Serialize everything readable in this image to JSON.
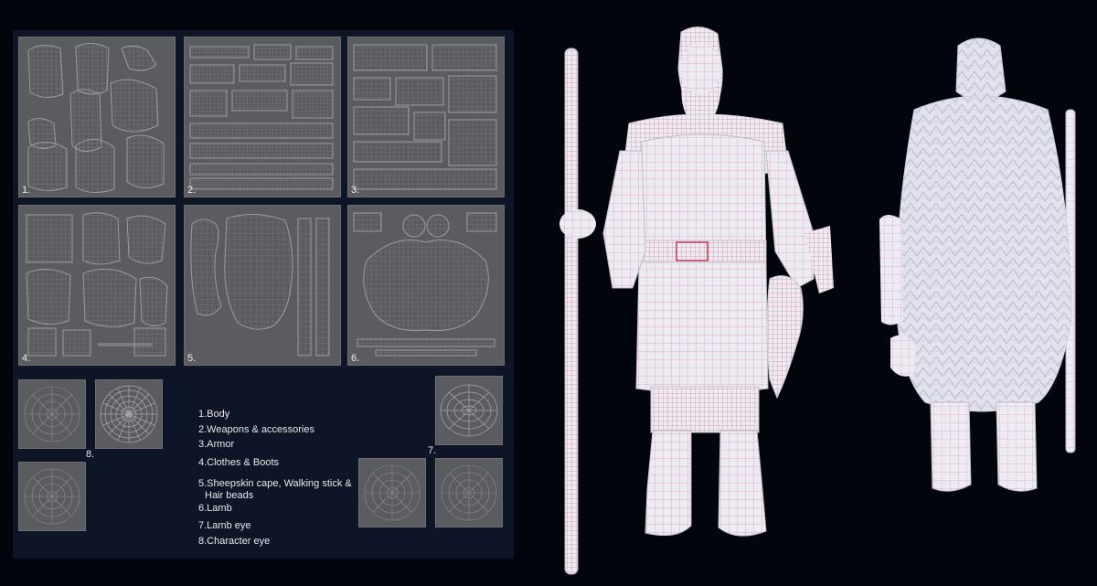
{
  "uv_labels": [
    "1.",
    "2.",
    "3.",
    "4.",
    "5.",
    "6.",
    "7.",
    "8."
  ],
  "legend": [
    "1.Body",
    "2.Weapons & accessories",
    "3.Armor",
    "4.Clothes & Boots",
    "5.Sheepskin cape, Walking stick &",
    "Hair beads",
    "6.Lamb",
    "7.Lamb eye",
    "8.Character eye"
  ],
  "colors": {
    "panel": "#0d1526",
    "uv_tile": "#5a5c5f",
    "wire": "#8b8d90",
    "model_base": "#eceaf4",
    "model_wire": "#d8435a",
    "background": "#03050d"
  }
}
